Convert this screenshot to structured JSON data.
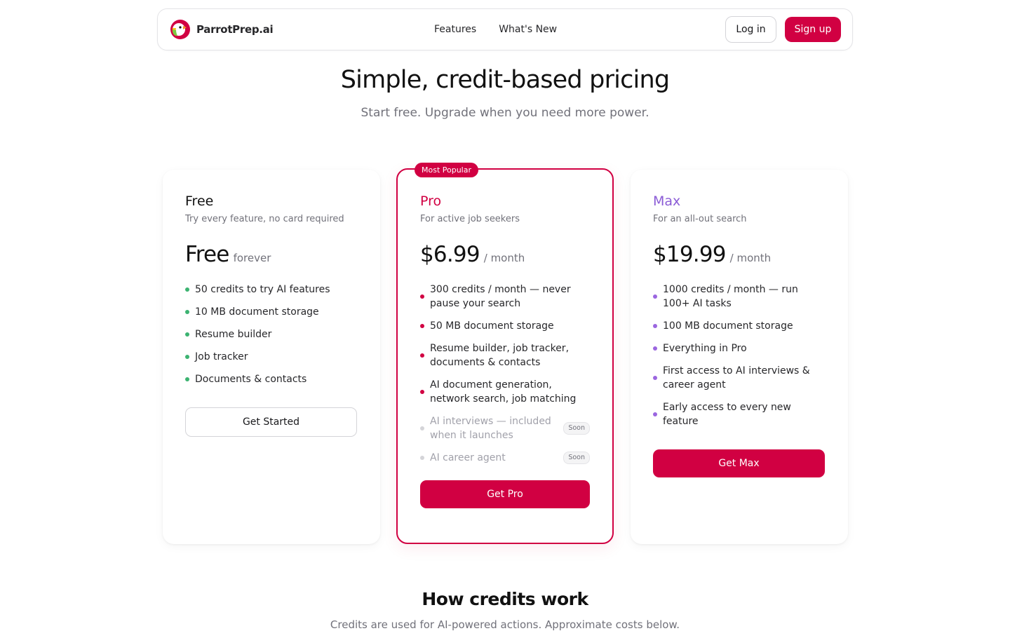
{
  "nav": {
    "brand": "ParrotPrep.ai",
    "links": [
      "Features",
      "What's New"
    ],
    "login_label": "Log in",
    "signup_label": "Sign up"
  },
  "hero": {
    "title": "Simple, credit-based pricing",
    "subtitle": "Start free. Upgrade when you need more power."
  },
  "plans": {
    "free": {
      "name": "Free",
      "description": "Try every feature, no card required",
      "price": "Free",
      "period": "forever",
      "features": [
        "50 credits to try AI features",
        "10 MB document storage",
        "Resume builder",
        "Job tracker",
        "Documents & contacts"
      ],
      "cta": "Get Started"
    },
    "pro": {
      "badge": "Most Popular",
      "name": "Pro",
      "description": "For active job seekers",
      "price": "$6.99",
      "period": "/ month",
      "features": [
        "300 credits / month — never pause your search",
        "50 MB document storage",
        "Resume builder, job tracker, documents & contacts",
        "AI document generation, network search, job matching"
      ],
      "coming_soon": [
        {
          "text": "AI interviews — included when it launches",
          "tag": "Soon"
        },
        {
          "text": "AI career agent",
          "tag": "Soon"
        }
      ],
      "cta": "Get Pro"
    },
    "max": {
      "name": "Max",
      "description": "For an all-out search",
      "price": "$19.99",
      "period": "/ month",
      "features": [
        "1000 credits / month — run 100+ AI tasks",
        "100 MB document storage",
        "Everything in Pro",
        "First access to AI interviews & career agent",
        "Early access to every new feature"
      ],
      "cta": "Get Max"
    }
  },
  "credits_section": {
    "title": "How credits work",
    "subtitle": "Credits are used for AI-powered actions. Approximate costs below."
  },
  "colors": {
    "brand": "#d10042",
    "max_accent": "#8b5cd6",
    "free_dot": "#3cb371"
  }
}
